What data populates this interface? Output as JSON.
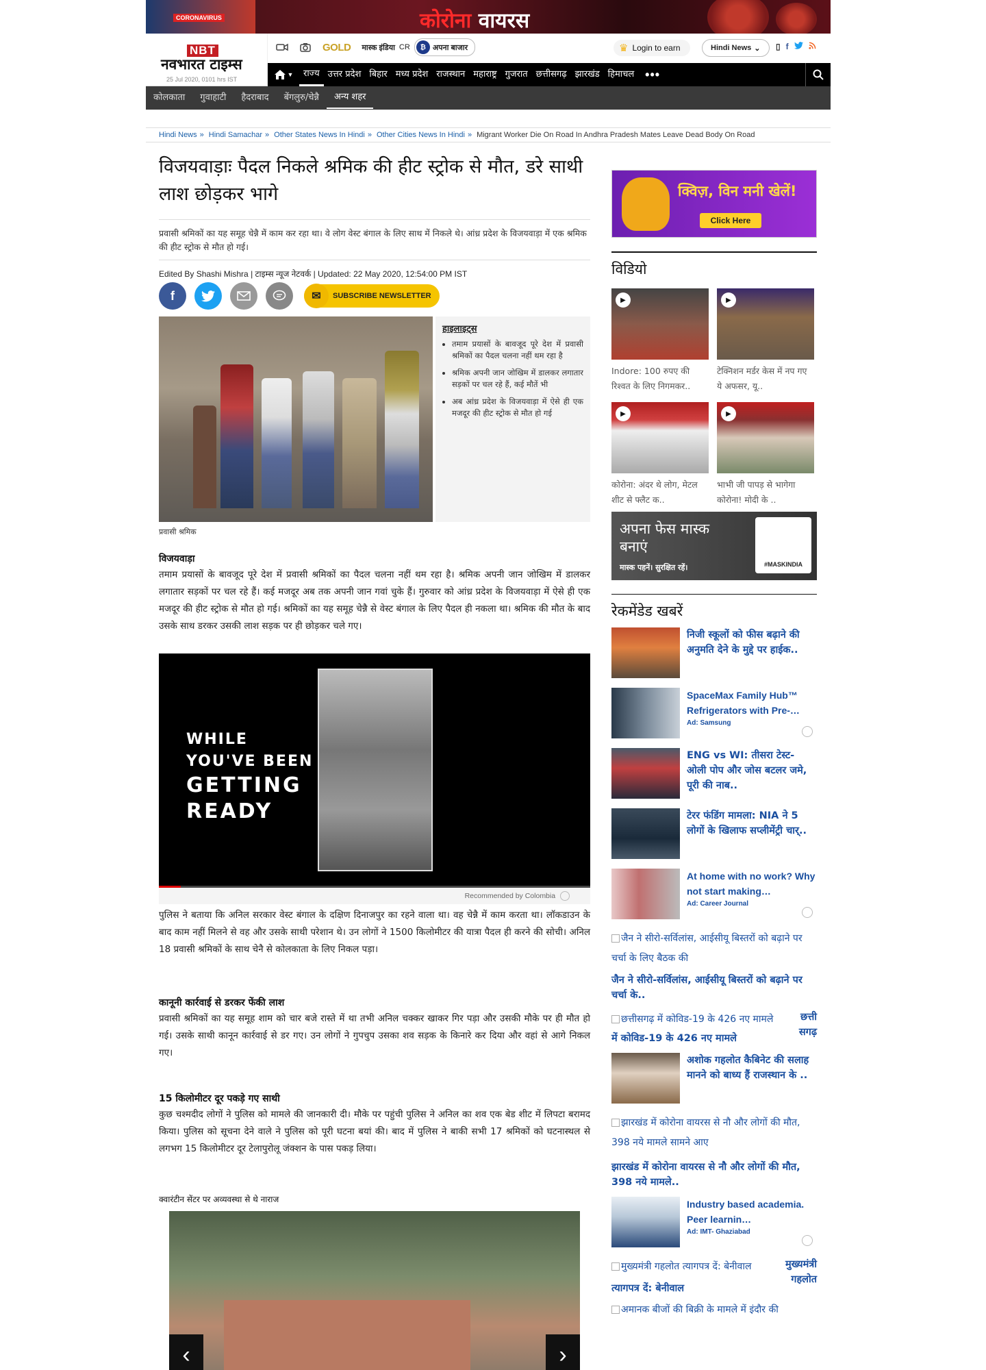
{
  "banner": {
    "title_red": "कोरोना",
    "title_white": "वायरस",
    "badge": "CORONAVIRUS"
  },
  "header": {
    "logo_short": "NBT",
    "logo_name": "नवभारत टाइम्स",
    "date": "25 Jul 2020, 0101 hrs IST",
    "gold": "GOLD",
    "mask_india": "मास्क इंडिया",
    "cr": "CR",
    "apna_bazar": "अपना बाजार",
    "login": "Login to earn",
    "language": "Hindi News"
  },
  "nav": {
    "items": [
      "राज्य",
      "उत्तर प्रदेश",
      "बिहार",
      "मध्य प्रदेश",
      "राजस्थान",
      "महाराष्ट्र",
      "गुजरात",
      "छत्तीसगढ़",
      "झारखंड",
      "हिमाचल"
    ],
    "more": "•••"
  },
  "subnav": {
    "items": [
      "कोलकाता",
      "गुवाहाटी",
      "हैदराबाद",
      "बेंगलुरु/चेन्नै",
      "अन्य शहर"
    ]
  },
  "breadcrumb": {
    "items": [
      "Hindi News",
      "Hindi Samachar",
      "Other States News In Hindi",
      "Other Cities News In Hindi"
    ],
    "current": "Migrant Worker Die On Road In Andhra Pradesh Mates Leave Dead Body On Road"
  },
  "article": {
    "title": "विजयवाड़ाः पैदल निकले श्रमिक की हीट स्ट्रोक से मौत, डरे साथी लाश छोड़कर भागे",
    "summary": "प्रवासी श्रमिकों का यह समूह चेन्नै में काम कर रहा था। वे लोग वेस्ट बंगाल के लिए साथ में निकले थे। आंध्र प्रदेश के विजयवाड़ा में एक श्रमिक की हीट स्ट्रोक से मौत हो गई।",
    "byline": "Edited By Shashi Mishra | टाइम्स न्यूज नेटवर्क | Updated: 22 May 2020, 12:54:00 PM IST",
    "newsletter": "SUBSCRIBE NEWSLETTER",
    "highlights_title": "हाइलाइट्स",
    "highlights": [
      "तमाम प्रयासों के बावजूद पूरे देश में प्रवासी श्रमिकों का पैदल चलना नहीं थम रहा है",
      "श्रमिक अपनी जान जोखिम में डालकर लगातार सड़कों पर चल रहे हैं, कई मौतें भी",
      "अब आंध्र प्रदेश के विजयवाड़ा में ऐसे ही एक मजदूर की हीट स्ट्रोक से मौत हो गई"
    ],
    "caption": "प्रवासी श्रमिक",
    "dateline": "विजयवाड़ा",
    "para1": "तमाम प्रयासों के बावजूद पूरे देश में प्रवासी श्रमिकों का पैदल चलना नहीं थम रहा है। श्रमिक अपनी जान जोखिम में डालकर लगातार सड़कों पर चल रहे हैं। कई मजदूर अब तक अपनी जान गवां चुके हैं। गुरुवार को आंध्र प्रदेश के विजयवाड़ा में ऐसे ही एक मजदूर की हीट स्ट्रोक से मौत हो गई। श्रमिकों का यह समूह चेन्नै से वेस्ट बंगाल के लिए पैदल ही नकला था। श्रमिक की मौत के बाद उसके साथ डरकर उसकी लाश सड़क पर ही छोड़कर चले गए।",
    "video_line1": "WHILE",
    "video_line2": "YOU'VE BEEN",
    "video_line3": "GETTING",
    "video_line4": "READY",
    "recommended": "Recommended by Colombia",
    "para2": "पुलिस ने बताया कि अनिल सरकार वेस्ट बंगाल के दक्षिण दिनाजपुर का रहने वाला था। वह चेन्नै में काम करता था। लॉकडाउन के बाद काम नहीं मिलने से वह और उसके साथी परेशान थे। उन लोगों ने 1500 किलोमीटर की यात्रा पैदल ही करने की सोची। अनिल 18 प्रवासी श्रमिकों के साथ चेनै से कोलकाता के लिए निकल पड़ा।",
    "sub1": "कानूनी कार्रवाई से डरकर फेंकी लाश",
    "para3": "प्रवासी श्रमिकों का यह समूह शाम को चार बजे रास्ते में था तभी अनिल चक्कर खाकर गिर पड़ा और उसकी मौके पर ही मौत हो गई। उसके साथी कानून कार्रवाई से डर गए। उन लोगों ने गुपचुप उसका शव सड़क के किनारे कर दिया और वहां से आगे निकल गए।",
    "sub2": "15 किलोमीटर दूर पकड़े गए साथी",
    "para4": "कुछ चश्मदीद लोगों ने पुलिस को मामले की जानकारी दी। मौके पर पहुंची पुलिस ने अनिल का शव एक बेड शीट में लिपटा बरामद किया। पुलिस को सूचना देने वाले ने पुलिस को पूरी घटना बयां की। बाद में पुलिस ने बाकी सभी 17 श्रमिकों को घटनास्थल से लगभग 15 किलोमीटर दूर टेलापुरोलू जंक्शन के पास पकड़ लिया।",
    "gallery_caption": "क्वारंटीन सेंटर पर अव्यवस्था से थे नाराज"
  },
  "sidebar": {
    "ad_title": "क्विज़, विन मनी खेलें!",
    "ad_button": "Click Here",
    "videos_title": "विडियो",
    "videos": [
      {
        "title": "Indore: 100 रुपए की रिश्वत के लिए निगमकर.."
      },
      {
        "title": "टेक्निशन मर्डर केस में नप गए ये अफसर, यू.."
      },
      {
        "title": "कोरोना: अंदर थे लोग, मेटल शीट से फ्लैट क.."
      },
      {
        "title": "भाभी जी पापड़ से भागेगा कोरोना! मोदी के .."
      }
    ],
    "mask_ad_line1": "अपना फेस मास्क",
    "mask_ad_line2": "बनाएं",
    "mask_ad_tag": "मास्क पहनें। सुरक्षित रहें।",
    "mask_ad_badge": "#MASKINDIA",
    "recommended_title": "रेकमेंडेड खबरें",
    "rec_items": [
      {
        "title": "निजी स्कूलों को फीस बढ़ाने की अनुमति देने के मुद्दे पर हाईक..",
        "ad": ""
      },
      {
        "title": "SpaceMax Family Hub™ Refrigerators with Pre-…",
        "ad": "Ad: Samsung"
      },
      {
        "title": "ENG vs WI: तीसरा टेस्ट- ओली पोप और जोस बटलर जमे, पूरी की नाब..",
        "ad": ""
      },
      {
        "title": "टेरर फंडिंग मामला: NIA ने 5 लोगों के खिलाफ सप्लीमेंट्री चार्..",
        "ad": ""
      },
      {
        "title": "At home with no work? Why not start making…",
        "ad": "Ad: Career Journal"
      }
    ],
    "broken1_alt": "जैन ने सीरो-सर्विलांस, आईसीयू बिस्तरों को बढ़ाने पर चर्चा के लिए बैठक की",
    "broken1_title": "जैन ने सीरो-सर्विलांस, आईसीयू बिस्तरों को बढ़ाने पर चर्चा के..",
    "broken2_alt": "छत्तीसगढ़ में कोविड-19 के 426 नए मामले",
    "broken2_title_a": "छत्ती सगढ़",
    "broken2_title_b": "में कोविड-19 के 426 नए मामले",
    "rec_item6": "अशोक गहलोत कैबिनेट की सलाह मानने को बाध्य हैं राजस्थान के ..",
    "broken3_alt": "झारखंड में कोरोना वायरस से नौ और लोगों की मौत, 398 नये मामले सामने आए",
    "broken3_title": "झारखंड में कोरोना वायरस से नौ और लोगों की मौत, 398 नये मामले..",
    "rec_item7": "Industry based academia. Peer learnin…",
    "rec_item7_ad": "Ad: IMT- Ghaziabad",
    "broken4_alt": "मुख्यमंत्री गहलोत त्यागपत्र दें: बेनीवाल",
    "broken4_title_a": "मुख्यमंत्री गहलोत",
    "broken4_title_b": "त्यागपत्र दें: बेनीवाल",
    "broken5_alt": "अमानक बीजों की बिक्री के मामले में इंदौर की"
  }
}
